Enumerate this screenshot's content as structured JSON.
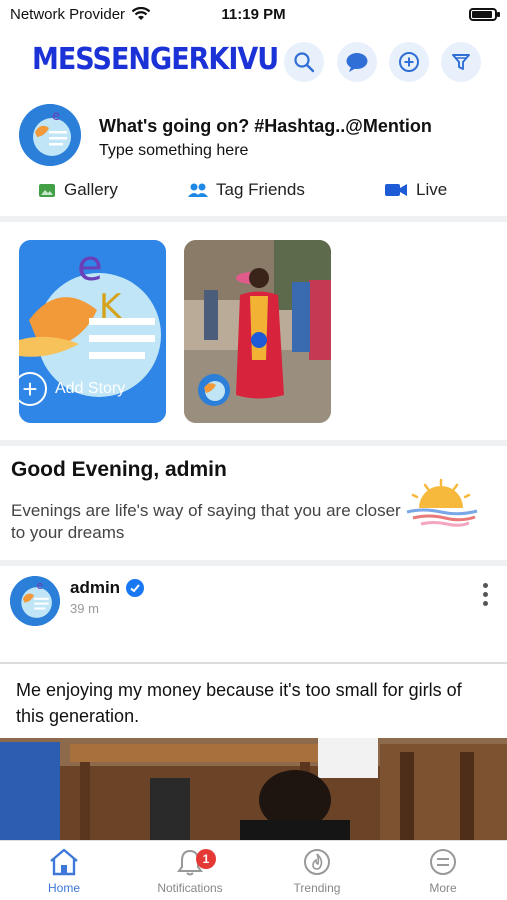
{
  "status_bar": {
    "carrier": "Network Provider",
    "time": "11:19 PM",
    "battery_level": 0.9
  },
  "header": {
    "logo": "MESSENGERKIVU",
    "icons": [
      "search-icon",
      "chat-icon",
      "add-icon",
      "filter-icon"
    ]
  },
  "composer": {
    "title": "What's going on? #Hashtag..@Mention",
    "placeholder": "Type something here",
    "actions": [
      {
        "label": "Gallery",
        "icon": "gallery-icon",
        "color": "#43a047"
      },
      {
        "label": "Tag Friends",
        "icon": "tag-friends-icon",
        "color": "#1e88e5"
      },
      {
        "label": "Live",
        "icon": "video-icon",
        "color": "#1e5bd6"
      }
    ]
  },
  "stories": {
    "add_label": "Add Story"
  },
  "greeting": {
    "title": "Good Evening, admin",
    "text": "Evenings are life's way of saying that you are closer to your dreams"
  },
  "post": {
    "author": "admin",
    "time": "39 m",
    "text": "Me enjoying my money because it's too small for girls of this generation."
  },
  "bottom_nav": {
    "items": [
      {
        "label": "Home",
        "icon": "home-icon",
        "active": true
      },
      {
        "label": "Notifications",
        "icon": "bell-icon",
        "badge": "1"
      },
      {
        "label": "Trending",
        "icon": "flame-icon"
      },
      {
        "label": "More",
        "icon": "menu-icon"
      }
    ]
  },
  "colors": {
    "accent": "#3d78d8",
    "logo": "#1b32d6",
    "badge": "#e53935",
    "icon_bg": "#e8f0fb"
  }
}
